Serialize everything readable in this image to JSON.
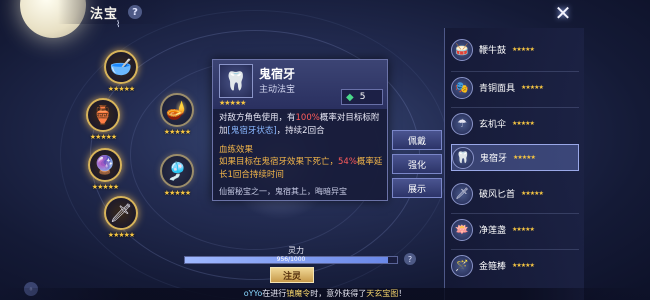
{
  "header": {
    "title": "法宝",
    "help": "?"
  },
  "icons": {
    "close": "✕",
    "bird": "⌇"
  },
  "colors": {
    "star": "#f5c542",
    "highlight_red": "#ff5c5c",
    "highlight_yellow": "#f3b64a"
  },
  "slots": [
    {
      "icon": "🥣",
      "stars": "★★★★★"
    },
    {
      "icon": "🏺",
      "stars": "★★★★★"
    },
    {
      "icon": "🔮",
      "stars": "★★★★★"
    },
    {
      "icon": "🗡",
      "stars": "★★★★★"
    },
    {
      "icon": "🪔",
      "stars": "★★★★★"
    },
    {
      "icon": "🎐",
      "stars": "★★★★★"
    }
  ],
  "detail": {
    "name": "鬼宿牙",
    "type": "主动法宝",
    "stars": "★★★★★",
    "gem_count": "5",
    "desc_a": "对敌方角色使用，有",
    "desc_pct": "100%",
    "desc_b": "概率对目标标附加",
    "desc_tag": "[鬼宿牙状态]",
    "desc_c": "，持续2回合",
    "blood_title": "血练效果",
    "blood_a": "如果目标在鬼宿牙效果下死亡，",
    "blood_pct": "54%",
    "blood_b": "概率延长1回合持续时间",
    "flavor": "仙留秘宝之一，鬼宿其上，晦暗异宝"
  },
  "actions": {
    "unequip": "佩戴",
    "upgrade": "强化",
    "show": "展示"
  },
  "list": [
    {
      "name": "鞭牛鼓",
      "stars": "★★★★★",
      "icon": "🥁"
    },
    {
      "name": "青铜面具",
      "stars": "★★★★★",
      "icon": "🎭"
    },
    {
      "name": "玄机伞",
      "stars": "★★★★★",
      "icon": "☂"
    },
    {
      "name": "鬼宿牙",
      "stars": "★★★★★",
      "icon": "🦷"
    },
    {
      "name": "破风匕首",
      "stars": "★★★★★",
      "icon": "🗡"
    },
    {
      "name": "净莲盏",
      "stars": "★★★★★",
      "icon": "🪷"
    },
    {
      "name": "金箍棒",
      "stars": "★★★★★",
      "icon": "🪄"
    }
  ],
  "spirit": {
    "label": "灵力",
    "value_text": "956/1000",
    "current": 956,
    "max": 1000,
    "help": "?"
  },
  "inject_label": "注灵",
  "broadcast": {
    "user": "oYYo",
    "a": "在进行",
    "event": "镇魔令",
    "b": "时，意外获得了",
    "item": "天玄宝图",
    "end": "！"
  },
  "chat_icon": "◦"
}
